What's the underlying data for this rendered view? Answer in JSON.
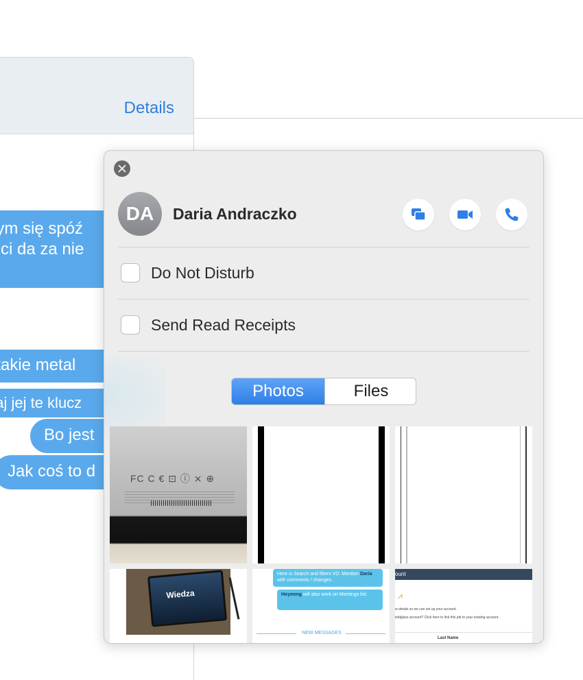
{
  "background_window": {
    "details_label": "Details",
    "messages": [
      "bym się spóź",
      "n ci da za nie",
      ", takie metal",
      "daj jej te klucz",
      "Bo jest",
      "Jak coś to d"
    ]
  },
  "popover": {
    "contact": {
      "initials": "DA",
      "name": "Daria Andraczko"
    },
    "actions": {
      "message_icon": "message-bubbles-icon",
      "video_icon": "video-camera-icon",
      "phone_icon": "phone-icon"
    },
    "options": {
      "do_not_disturb": {
        "label": "Do Not Disturb",
        "checked": false
      },
      "send_read_receipts": {
        "label": "Send Read Receipts",
        "checked": false
      }
    },
    "segmented": {
      "photos": "Photos",
      "files": "Files",
      "selected": "Photos"
    },
    "thumbnails": {
      "tablet_screen_title": "Wiedza",
      "chat_chip_1_pre": "Here is Search and filters VD. Mention ",
      "chat_chip_1_name": "Daria",
      "chat_chip_1_post": " with comments / changes.",
      "chat_chip_2_name": "Hoyeong",
      "chat_chip_2_post": " will also work on Meetings list.",
      "new_messages": "NEW MESSAGES",
      "doc_header": "ount",
      "doc_line_1": "w details so we can set up your account.",
      "doc_line_2": "ieldglass account? Click here to link this job to your existing account.",
      "doc_line_3": "",
      "doc_field_label": "Last Name"
    }
  },
  "colors": {
    "accent_blue": "#2f7fe6",
    "bubble_blue": "#5aa9ec",
    "link_blue": "#2f7ed8"
  }
}
